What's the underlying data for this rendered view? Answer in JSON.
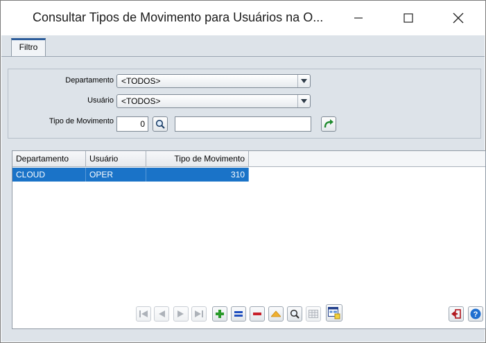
{
  "window": {
    "title": "Consultar Tipos de Movimento para Usuários na O..."
  },
  "tabs": [
    {
      "label": "Filtro"
    }
  ],
  "filter": {
    "departamento_label": "Departamento",
    "departamento_value": "<TODOS>",
    "usuario_label": "Usuário",
    "usuario_value": "<TODOS>",
    "tipo_label": "Tipo de Movimento",
    "tipo_code": "0",
    "tipo_description": ""
  },
  "grid": {
    "columns": [
      "Departamento",
      "Usuário",
      "Tipo de Movimento"
    ],
    "rows": [
      [
        "CLOUD",
        "OPER",
        "310"
      ]
    ]
  },
  "colors": {
    "selection": "#1a73c8",
    "accent": "#2c5c9a"
  },
  "icons": {
    "navigation": [
      "first-icon",
      "previous-icon",
      "next-icon",
      "last-icon"
    ],
    "actions": [
      "add-icon",
      "edit-icon",
      "delete-icon",
      "up-icon",
      "search-icon",
      "grid-view-icon",
      "details-icon"
    ],
    "bottom_right": [
      "exit-icon",
      "help-icon"
    ]
  }
}
